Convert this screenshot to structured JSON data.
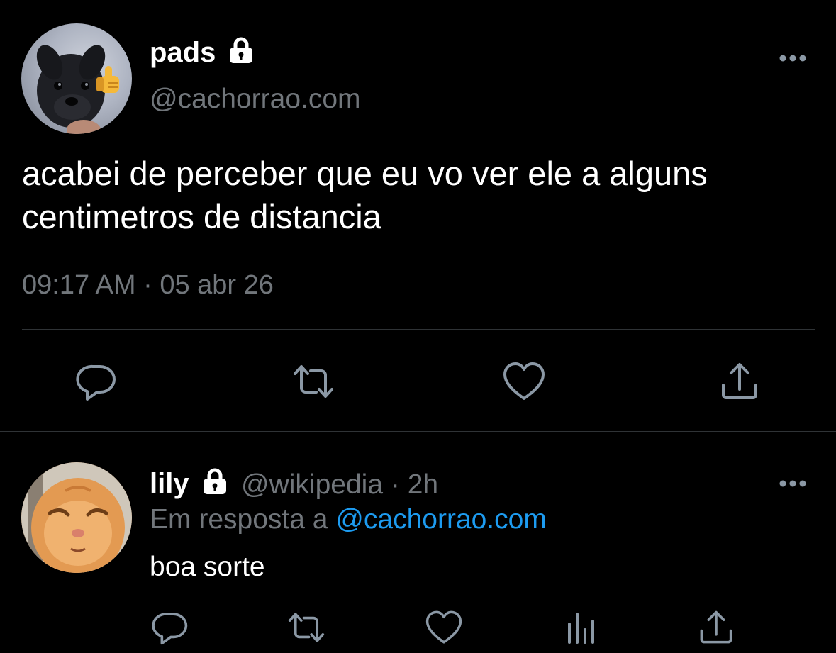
{
  "main_tweet": {
    "display_name": "pads",
    "handle": "@cachorrao.com",
    "text": "acabei de perceber que eu vo ver ele a alguns centimetros de distancia",
    "time": "09:17 AM",
    "separator": "·",
    "date": "05 abr 26",
    "protected_icon": "lock-icon",
    "more_icon": "more-dots-icon",
    "actions": [
      "reply-icon",
      "retweet-icon",
      "like-icon",
      "share-icon"
    ]
  },
  "reply_tweet": {
    "display_name": "lily",
    "handle": "@wikipedia",
    "separator": "·",
    "age": "2h",
    "in_reply_prefix": "Em resposta a",
    "in_reply_to": "@cachorrao.com",
    "text": "boa sorte",
    "protected_icon": "lock-icon",
    "more_icon": "more-dots-icon",
    "actions": [
      "reply-icon",
      "retweet-icon",
      "like-icon",
      "analytics-icon",
      "share-icon"
    ]
  },
  "colors": {
    "background": "#000000",
    "text_primary": "#ffffff",
    "text_secondary": "#71767b",
    "icon": "#8b98a5",
    "divider": "#2f3336",
    "link": "#1d9bf0"
  }
}
